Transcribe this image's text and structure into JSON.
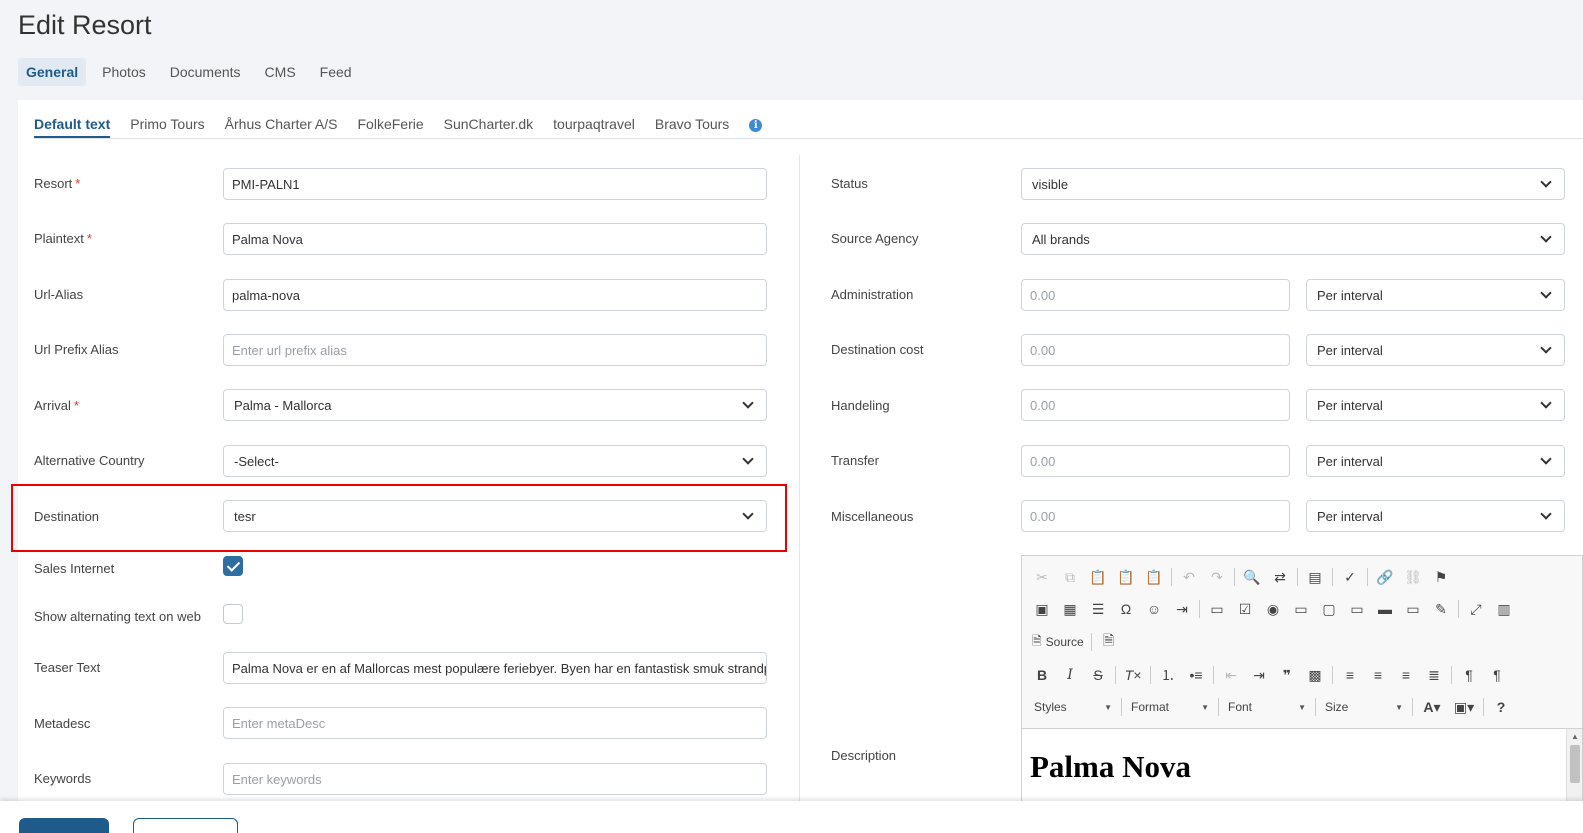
{
  "page": {
    "title": "Edit Resort"
  },
  "top_tabs": [
    {
      "label": "General",
      "active": true
    },
    {
      "label": "Photos",
      "active": false
    },
    {
      "label": "Documents",
      "active": false
    },
    {
      "label": "CMS",
      "active": false
    },
    {
      "label": "Feed",
      "active": false
    }
  ],
  "sub_tabs": [
    {
      "label": "Default text",
      "active": true
    },
    {
      "label": "Primo Tours"
    },
    {
      "label": "Århus Charter A/S"
    },
    {
      "label": "FolkeFerie"
    },
    {
      "label": "SunCharter.dk"
    },
    {
      "label": "tourpaqtravel"
    },
    {
      "label": "Bravo Tours"
    }
  ],
  "left_form": {
    "resort": {
      "label": "Resort",
      "required": "*",
      "value": "PMI-PALN1"
    },
    "plaintext": {
      "label": "Plaintext",
      "required": "*",
      "value": "Palma Nova"
    },
    "url_alias": {
      "label": "Url-Alias",
      "value": "palma-nova"
    },
    "url_prefix_alias": {
      "label": "Url Prefix Alias",
      "placeholder": "Enter url prefix alias"
    },
    "arrival": {
      "label": "Arrival",
      "required": "*",
      "value": "Palma - Mallorca"
    },
    "alt_country": {
      "label": "Alternative Country",
      "value": "-Select-"
    },
    "destination": {
      "label": "Destination",
      "value": "tesr"
    },
    "sales_internet": {
      "label": "Sales Internet",
      "checked": true
    },
    "show_alt_text": {
      "label": "Show alternating text on web",
      "checked": false
    },
    "teaser": {
      "label": "Teaser Text",
      "value": "Palma Nova er en af Mallorcas mest populære feriebyer. Byen har en fantastisk smuk strandp"
    },
    "metadesc": {
      "label": "Metadesc",
      "placeholder": "Enter metaDesc"
    },
    "keywords": {
      "label": "Keywords",
      "placeholder": "Enter keywords"
    }
  },
  "right_form": {
    "status": {
      "label": "Status",
      "value": "visible"
    },
    "source_agency": {
      "label": "Source Agency",
      "value": "All brands"
    },
    "administration": {
      "label": "Administration",
      "placeholder": "0.00",
      "interval": "Per interval"
    },
    "destination_cost": {
      "label": "Destination cost",
      "placeholder": "0.00",
      "interval": "Per interval"
    },
    "handeling": {
      "label": "Handeling",
      "placeholder": "0.00",
      "interval": "Per interval"
    },
    "transfer": {
      "label": "Transfer",
      "placeholder": "0.00",
      "interval": "Per interval"
    },
    "miscellaneous": {
      "label": "Miscellaneous",
      "placeholder": "0.00",
      "interval": "Per interval"
    },
    "description": {
      "label": "Description"
    }
  },
  "editor": {
    "source_label": "Source",
    "styles_label": "Styles",
    "format_label": "Format",
    "font_label": "Font",
    "size_label": "Size",
    "heading": "Palma Nova"
  },
  "colors": {
    "accent": "#1f5b8a",
    "highlight": "#ee0000",
    "checkbox": "#2c6fa0"
  }
}
